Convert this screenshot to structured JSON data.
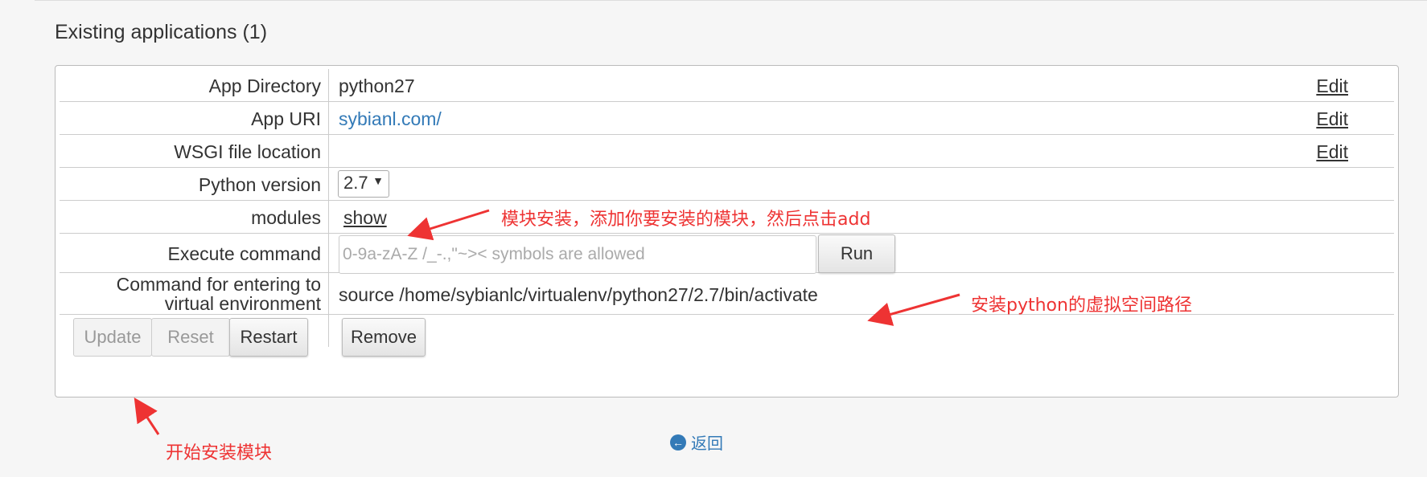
{
  "section_title": "Existing applications (1)",
  "rows": {
    "app_directory": {
      "label": "App Directory",
      "value": "python27",
      "edit": "Edit"
    },
    "app_uri": {
      "label": "App URI",
      "value": "sybianl.com/",
      "edit": "Edit"
    },
    "wsgi": {
      "label": "WSGI file location",
      "value": "",
      "edit": "Edit"
    },
    "python_version": {
      "label": "Python version",
      "selected": "2.7"
    },
    "modules": {
      "label": "modules",
      "link": "show"
    },
    "execute": {
      "label": "Execute command",
      "placeholder": "0-9a-zA-Z /_-.,\"~>< symbols are allowed",
      "button": "Run"
    },
    "venv": {
      "label_line1": "Command for entering to",
      "label_line2": "virtual environment",
      "value": "source /home/sybianlc/virtualenv/python27/2.7/bin/activate"
    }
  },
  "buttons": {
    "update": "Update",
    "reset": "Reset",
    "restart": "Restart",
    "remove": "Remove"
  },
  "annotations": {
    "modules_note": "模块安装，添加你要安装的模块，然后点击add",
    "venv_note": "安装python的虚拟空间路径",
    "update_note": "开始安装模块"
  },
  "back": {
    "icon": "arrow-left-circle-icon",
    "label": "返回"
  },
  "colors": {
    "link": "#337ab7",
    "annotation": "#e33333"
  }
}
